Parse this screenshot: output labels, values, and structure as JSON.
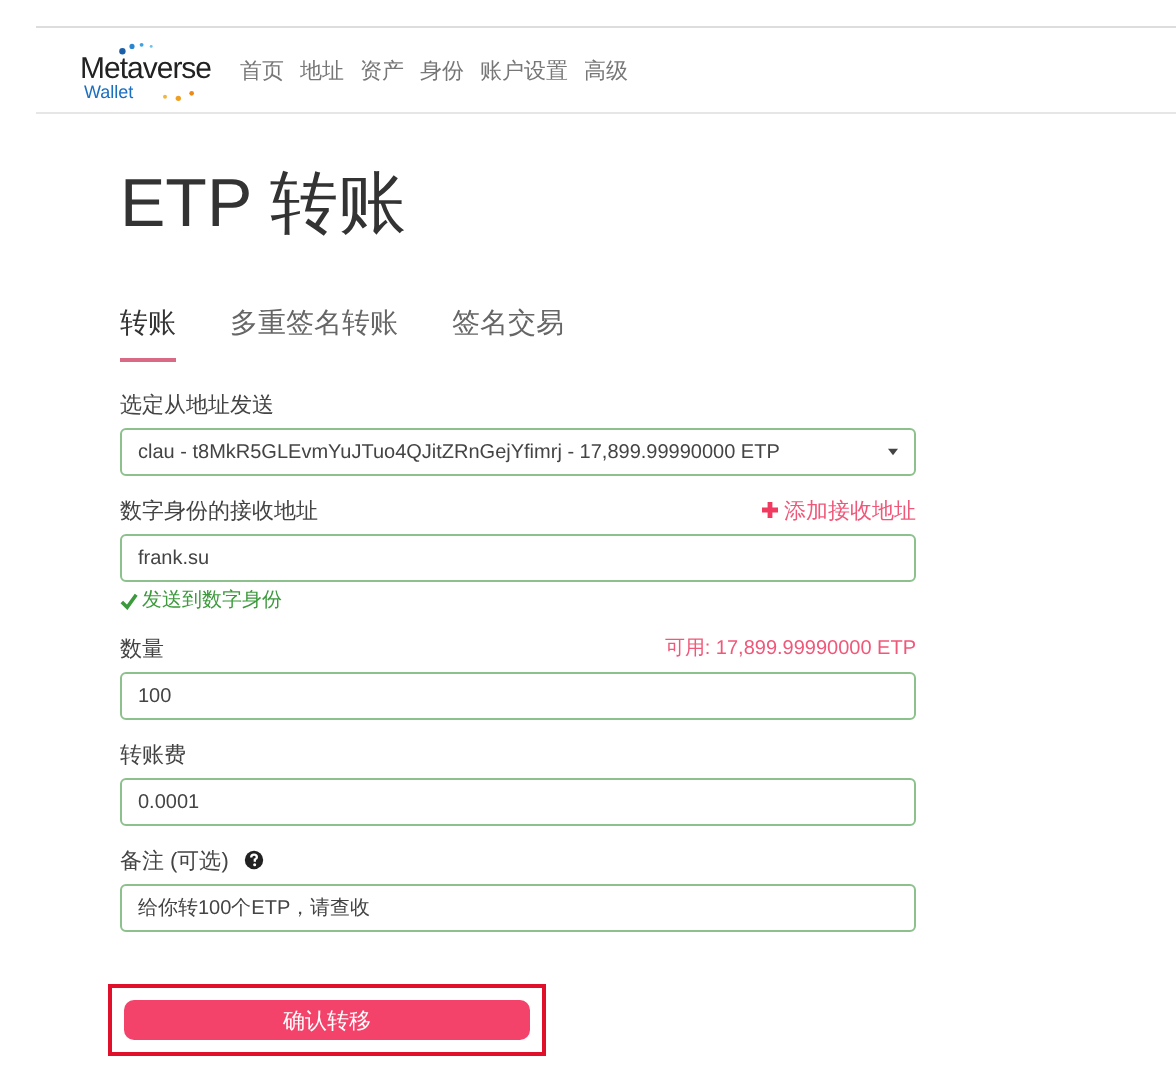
{
  "logo": {
    "name": "Metaverse",
    "sub": "Wallet"
  },
  "nav": [
    {
      "label": "首页"
    },
    {
      "label": "地址"
    },
    {
      "label": "资产"
    },
    {
      "label": "身份"
    },
    {
      "label": "账户设置"
    },
    {
      "label": "高级"
    }
  ],
  "title": "ETP 转账",
  "tabs": [
    {
      "label": "转账",
      "selected": true
    },
    {
      "label": "多重签名转账",
      "selected": false
    },
    {
      "label": "签名交易",
      "selected": false
    }
  ],
  "fields": [
    {
      "kind": "select",
      "label": "选定从地址发送",
      "value": "clau - t8MkR5GLEvmYuJTuo4QJitZRnGejYfimrj - 17,899.99990000 ETP"
    },
    {
      "kind": "input",
      "label": "数字身份的接收地址",
      "action": "添加接收地址",
      "value": "frank.su",
      "hint": "发送到数字身份"
    },
    {
      "kind": "input",
      "label": "数量",
      "note": "可用: 17,899.99990000 ETP",
      "value": "100"
    },
    {
      "kind": "input",
      "label": "转账费",
      "value": "0.0001"
    },
    {
      "kind": "input",
      "label": "备注 (可选)",
      "help": true,
      "value": "给你转100个ETP，请查收"
    }
  ],
  "submit": {
    "label": "确认转移",
    "highlighted": true
  }
}
